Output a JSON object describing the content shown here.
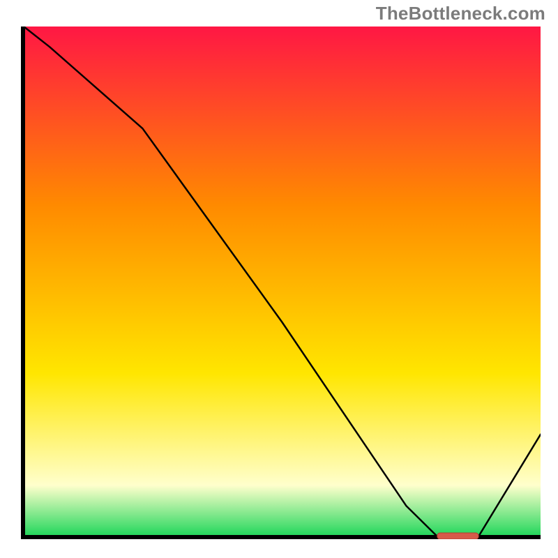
{
  "watermark": "TheBottleneck.com",
  "colors": {
    "axis": "#000000",
    "curve": "#000000",
    "marker_fill": "#d65a4a",
    "marker_stroke": "#b23e30",
    "gradient_top": "#ff1744",
    "gradient_mid_upper": "#ff8a00",
    "gradient_mid_lower": "#ffe600",
    "gradient_pale": "#ffffcc",
    "gradient_green": "#1fd65a"
  },
  "chart_data": {
    "type": "line",
    "title": "",
    "xlabel": "",
    "ylabel": "",
    "xlim": [
      0,
      100
    ],
    "ylim": [
      0,
      100
    ],
    "grid": false,
    "legend": false,
    "x": [
      0,
      5,
      23,
      50,
      74,
      80,
      88,
      100
    ],
    "values": [
      100,
      96,
      80,
      42,
      6,
      0,
      0,
      20
    ],
    "marker": {
      "x_start": 80,
      "x_end": 88,
      "y": 0
    },
    "notes": "Background is a vertical heat gradient (red→orange→yellow→pale→green). Curve descends from top-left, kinks near x≈23, reaches 0 around x≈80–88 where a small salmon marker sits on the axis, then rises to the right."
  }
}
